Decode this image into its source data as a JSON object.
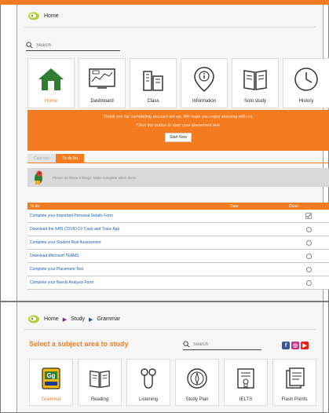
{
  "top": {
    "breadcrumb": [
      "Home"
    ],
    "search_placeholder": "Search",
    "tiles": [
      {
        "label": "Home",
        "icon": "house-icon",
        "active": true
      },
      {
        "label": "Dashboard",
        "icon": "dashboard-icon",
        "active": false
      },
      {
        "label": "Class",
        "icon": "building-icon",
        "active": false
      },
      {
        "label": "Information",
        "icon": "info-pin-icon",
        "active": false
      },
      {
        "label": "Solo study",
        "icon": "book-icon",
        "active": false
      },
      {
        "label": "History",
        "icon": "clock-icon",
        "active": false
      }
    ],
    "banner": {
      "line1": "Thank you for completing account set up. We hope you enjoy studying with us.",
      "line2": "Click the button to start your placement test",
      "button": "Start Now"
    },
    "tabs": [
      "Calendar",
      "To do list"
    ],
    "notice": "Please do these 6 things. Make complete when done.",
    "table": {
      "headers": [
        "To do",
        "Date",
        "Done"
      ],
      "rows": [
        {
          "task": "Complete your Important Personal Details Form",
          "done": true
        },
        {
          "task": "Download the NHS COVID-19 Track and Trace App",
          "done": false
        },
        {
          "task": "Complete your Student Risk Assessment",
          "done": false
        },
        {
          "task": "Download Microsoft TEAMS",
          "done": false
        },
        {
          "task": "Complete your Placement Test",
          "done": false
        },
        {
          "task": "Complete your Needs Analysis Form",
          "done": false
        }
      ]
    }
  },
  "bottom": {
    "breadcrumb": [
      "Home",
      "Study",
      "Grammar"
    ],
    "title": "Select a subject area to study",
    "search_placeholder": "Search",
    "social": [
      {
        "name": "facebook-icon",
        "glyph": "f",
        "color": "#3b5998"
      },
      {
        "name": "instagram-icon",
        "glyph": "◎",
        "color": "#c13584"
      },
      {
        "name": "youtube-icon",
        "glyph": "▶",
        "color": "#e62117"
      }
    ],
    "tiles": [
      {
        "label": "Grammar",
        "icon": "gg-book-icon",
        "active": true
      },
      {
        "label": "Reading",
        "icon": "book-icon",
        "active": false
      },
      {
        "label": "Listening",
        "icon": "earphones-icon",
        "active": false
      },
      {
        "label": "Study Plan",
        "icon": "compass-icon",
        "active": false
      },
      {
        "label": "IELTS",
        "icon": "certificate-icon",
        "active": false
      },
      {
        "label": "Flash Points",
        "icon": "notes-icon",
        "active": false
      }
    ]
  },
  "colors": {
    "accent": "#f47b20",
    "link": "#1e5aa8",
    "logo": "#b5cf3a"
  }
}
